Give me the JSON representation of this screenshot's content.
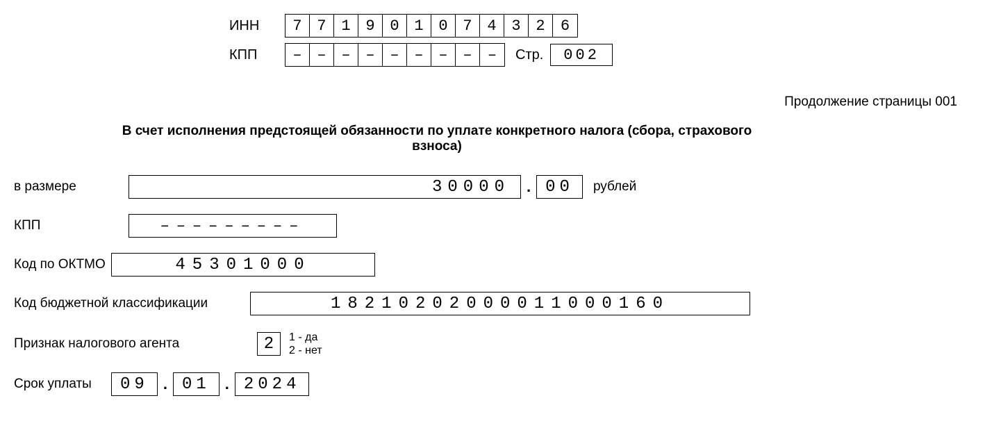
{
  "header": {
    "inn_label": "ИНН",
    "inn_digits": [
      "7",
      "7",
      "1",
      "9",
      "0",
      "1",
      "0",
      "7",
      "4",
      "3",
      "2",
      "6"
    ],
    "kpp_label": "КПП",
    "kpp_digits": [
      "–",
      "–",
      "–",
      "–",
      "–",
      "–",
      "–",
      "–",
      "–"
    ],
    "page_label": "Стр.",
    "page_number": "002"
  },
  "continuation_text": "Продолжение страницы 001",
  "section_title": "В счет исполнения предстоящей обязанности по уплате конкретного налога (сбора, страхового взноса)",
  "amount": {
    "label": "в размере",
    "integer": "30000",
    "separator": ".",
    "decimal": "00",
    "unit": "рублей"
  },
  "kpp2": {
    "label": "КПП",
    "value": "–––––––––"
  },
  "oktmo": {
    "label": "Код по ОКТМО",
    "value": "45301000"
  },
  "kbk": {
    "label": "Код бюджетной классификации",
    "value": "18210202000011000160"
  },
  "agent": {
    "label": "Признак налогового агента",
    "value": "2",
    "legend1": "1 - да",
    "legend2": "2 - нет"
  },
  "deadline": {
    "label": "Срок уплаты",
    "day": "09",
    "month": "01",
    "year": "2024",
    "separator": "."
  }
}
